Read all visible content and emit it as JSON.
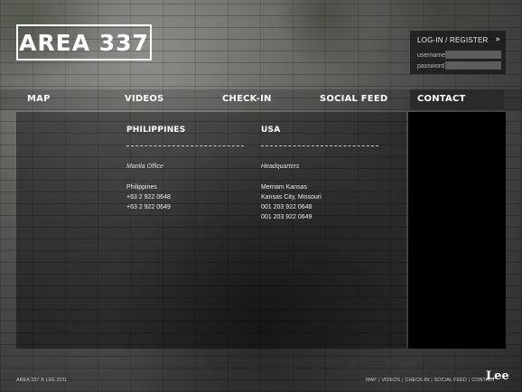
{
  "brand": {
    "logo_text": "AREA 337"
  },
  "login": {
    "title": "LOG-IN / REGISTER",
    "arrow": "»",
    "username_label": "username",
    "password_label": "password"
  },
  "nav": {
    "items": [
      {
        "label": "MAP"
      },
      {
        "label": "VIDEOS"
      },
      {
        "label": "CHECK-IN"
      },
      {
        "label": "SOCIAL FEED"
      },
      {
        "label": "CONTACT"
      }
    ]
  },
  "contact": {
    "offices": [
      {
        "country": "PHILIPPINES",
        "office": "Manila Office",
        "lines": [
          "Philippines",
          "+63 2 922 0648",
          "+63 2 922 0649"
        ]
      },
      {
        "country": "USA",
        "office": "Headquarters",
        "lines": [
          "Merriam Kansas",
          "Kansas City, Missouri",
          "001 203 922 0648",
          "001 203 922 0649"
        ]
      }
    ]
  },
  "footer": {
    "copyright": "AREA 337 ® LEE 2011",
    "links": [
      "MAP",
      "VIDEOS",
      "CHECK-IN",
      "SOCIAL FEED",
      "CONTACT"
    ],
    "brand_logo": "Lee"
  }
}
